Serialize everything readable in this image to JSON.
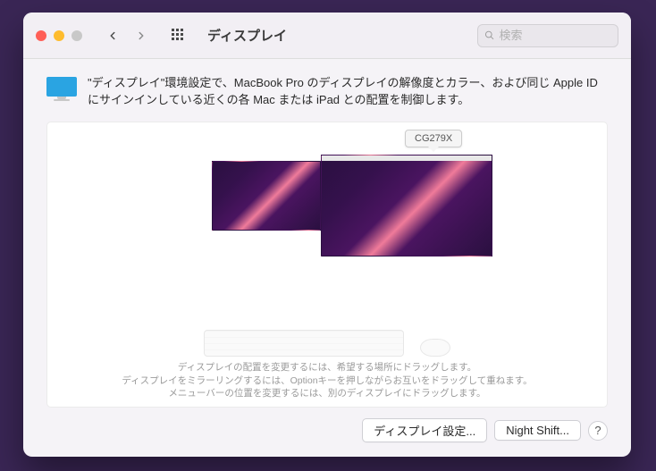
{
  "window": {
    "title": "ディスプレイ"
  },
  "search": {
    "placeholder": "検索"
  },
  "intro": {
    "text": "\"ディスプレイ\"環境設定で、MacBook Pro のディスプレイの解像度とカラー、および同じ Apple ID にサインインしている近くの各 Mac または iPad との配置を制御します。"
  },
  "arrangement": {
    "tooltip": "CG279X",
    "hint1": "ディスプレイの配置を変更するには、希望する場所にドラッグします。",
    "hint2": "ディスプレイをミラーリングするには、Optionキーを押しながらお互いをドラッグして重ねます。",
    "hint3": "メニューバーの位置を変更するには、別のディスプレイにドラッグします。"
  },
  "footer": {
    "display_settings": "ディスプレイ設定...",
    "night_shift": "Night Shift...",
    "help": "?"
  }
}
